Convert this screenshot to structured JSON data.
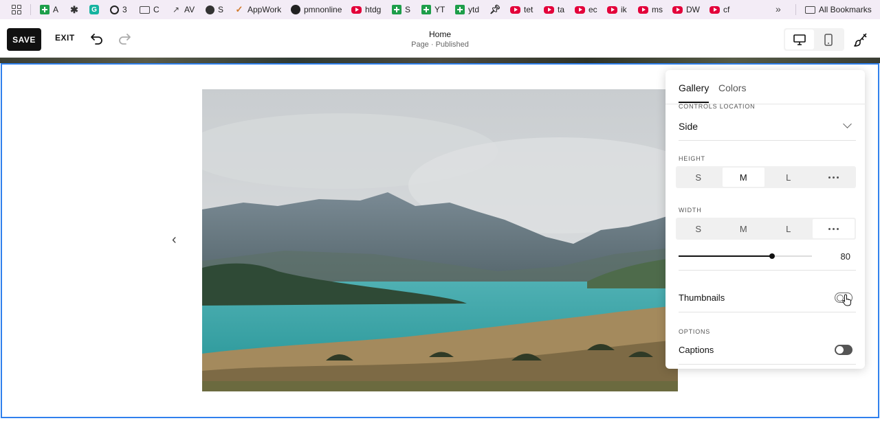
{
  "bookmarks": [
    {
      "label": "A",
      "icon": "sheets-icon"
    },
    {
      "label": "",
      "icon": "puzzle-icon"
    },
    {
      "label": "",
      "icon": "grammarly-icon"
    },
    {
      "label": "3",
      "icon": "threads-icon"
    },
    {
      "label": "C",
      "icon": "folder-icon"
    },
    {
      "label": "AV",
      "icon": "chart-icon"
    },
    {
      "label": "S",
      "icon": "globe-icon"
    },
    {
      "label": "AppWork",
      "icon": "check-icon"
    },
    {
      "label": "pmnonline",
      "icon": "github-icon"
    },
    {
      "label": "htdg",
      "icon": "youtube-icon"
    },
    {
      "label": "S",
      "icon": "sheets-icon"
    },
    {
      "label": "YT",
      "icon": "sheets-icon"
    },
    {
      "label": "ytd",
      "icon": "sheets-icon"
    },
    {
      "label": "",
      "icon": "pin-icon"
    },
    {
      "label": "tet",
      "icon": "youtube-icon"
    },
    {
      "label": "ta",
      "icon": "youtube-icon"
    },
    {
      "label": "ec",
      "icon": "youtube-icon"
    },
    {
      "label": "ik",
      "icon": "youtube-icon"
    },
    {
      "label": "ms",
      "icon": "youtube-icon"
    },
    {
      "label": "DW",
      "icon": "youtube-icon"
    },
    {
      "label": "cf",
      "icon": "youtube-icon"
    }
  ],
  "all_bookmarks": "All Bookmarks",
  "toolbar": {
    "save": "SAVE",
    "exit": "EXIT",
    "page_title": "Home",
    "page_status": "Page · Published"
  },
  "panel": {
    "tabs": [
      "Gallery",
      "Colors"
    ],
    "active_tab": "Gallery",
    "controls_location_label": "CONTROLS LOCATION",
    "controls_location_value": "Side",
    "height_label": "HEIGHT",
    "height_options": [
      "S",
      "M",
      "L"
    ],
    "height_selected": "M",
    "width_label": "WIDTH",
    "width_options": [
      "S",
      "M",
      "L"
    ],
    "width_selected": "more",
    "width_value": "80",
    "width_fraction": 0.7,
    "thumbnails_label": "Thumbnails",
    "thumbnails_on": false,
    "options_label": "OPTIONS",
    "captions_label": "Captions",
    "captions_on": false
  },
  "colors": {
    "selection_border": "#2f80ed",
    "save_bg": "#111111"
  }
}
